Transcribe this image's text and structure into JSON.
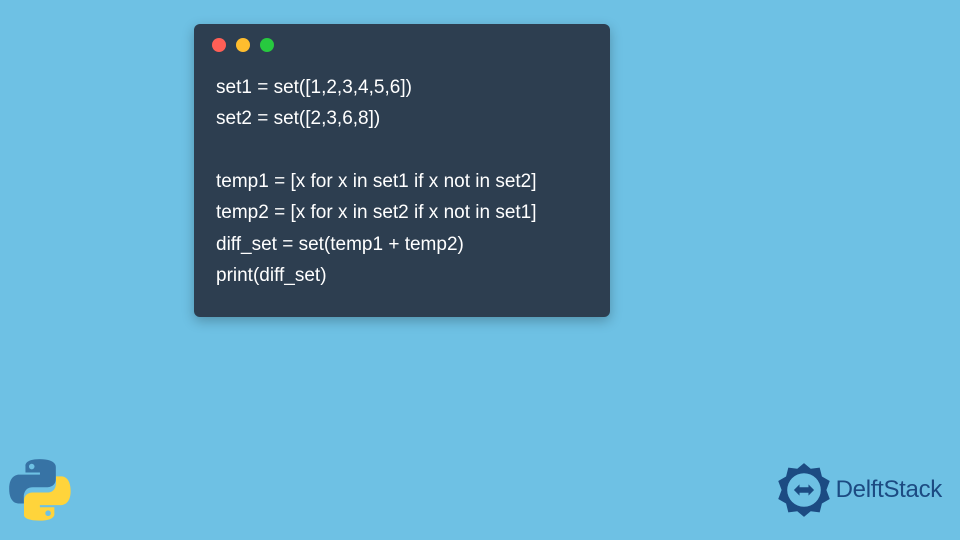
{
  "window": {
    "dots": [
      "red",
      "yellow",
      "green"
    ]
  },
  "code": {
    "lines": [
      "set1 = set([1,2,3,4,5,6])",
      "set2 = set([2,3,6,8])",
      "",
      "temp1 = [x for x in set1 if x not in set2]",
      "temp2 = [x for x in set2 if x not in set1]",
      "diff_set = set(temp1 + temp2)",
      "print(diff_set)"
    ]
  },
  "branding": {
    "name": "DelftStack"
  },
  "colors": {
    "background": "#6ec1e4",
    "code_bg": "#2d3e50",
    "code_fg": "#ffffff",
    "brand": "#1c4b82"
  }
}
